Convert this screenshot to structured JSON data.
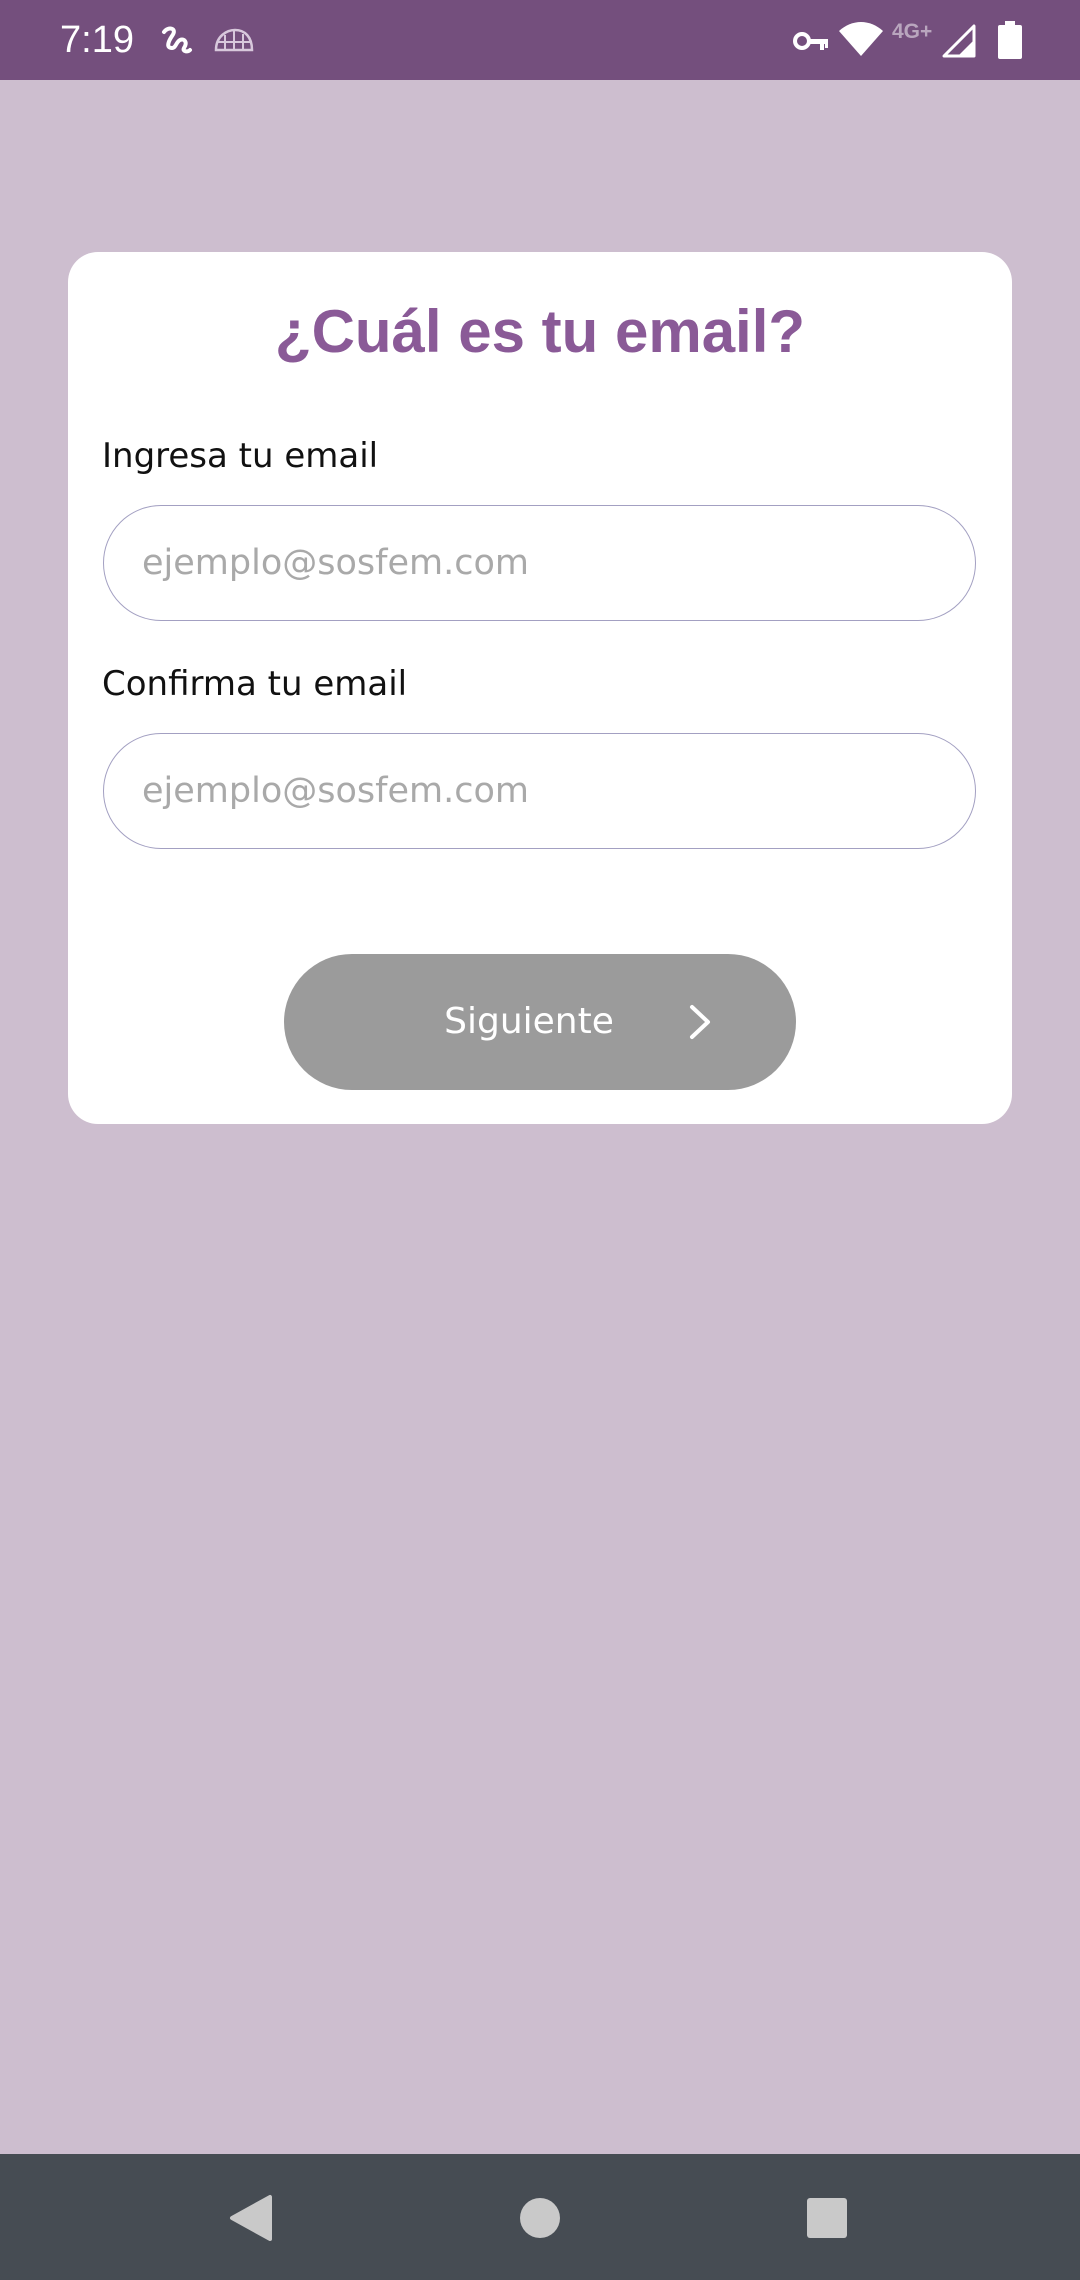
{
  "status_bar": {
    "time": "7:19",
    "network_label": "4G+",
    "icons": [
      "app-notification-icon",
      "keyboard-icon",
      "vpn-key-icon",
      "wifi-icon",
      "cellular-signal-icon",
      "battery-icon"
    ],
    "background_color": "#744f7d"
  },
  "card": {
    "title": "¿Cuál es tu email?",
    "title_color": "#8a5a97",
    "email_label": "Ingresa tu email",
    "email_placeholder": "ejemplo@sosfem.com",
    "confirm_label": "Confirma tu email",
    "confirm_placeholder": "ejemplo@sosfem.com",
    "next_button": {
      "label": "Siguiente",
      "icon": "chevron-right-icon",
      "state": "disabled",
      "color": "#9b9b9b"
    }
  },
  "nav_bar": {
    "icons": [
      "back-icon",
      "home-icon",
      "recents-icon"
    ],
    "background_color": "#464c53"
  },
  "page_background": "#cdbecf"
}
